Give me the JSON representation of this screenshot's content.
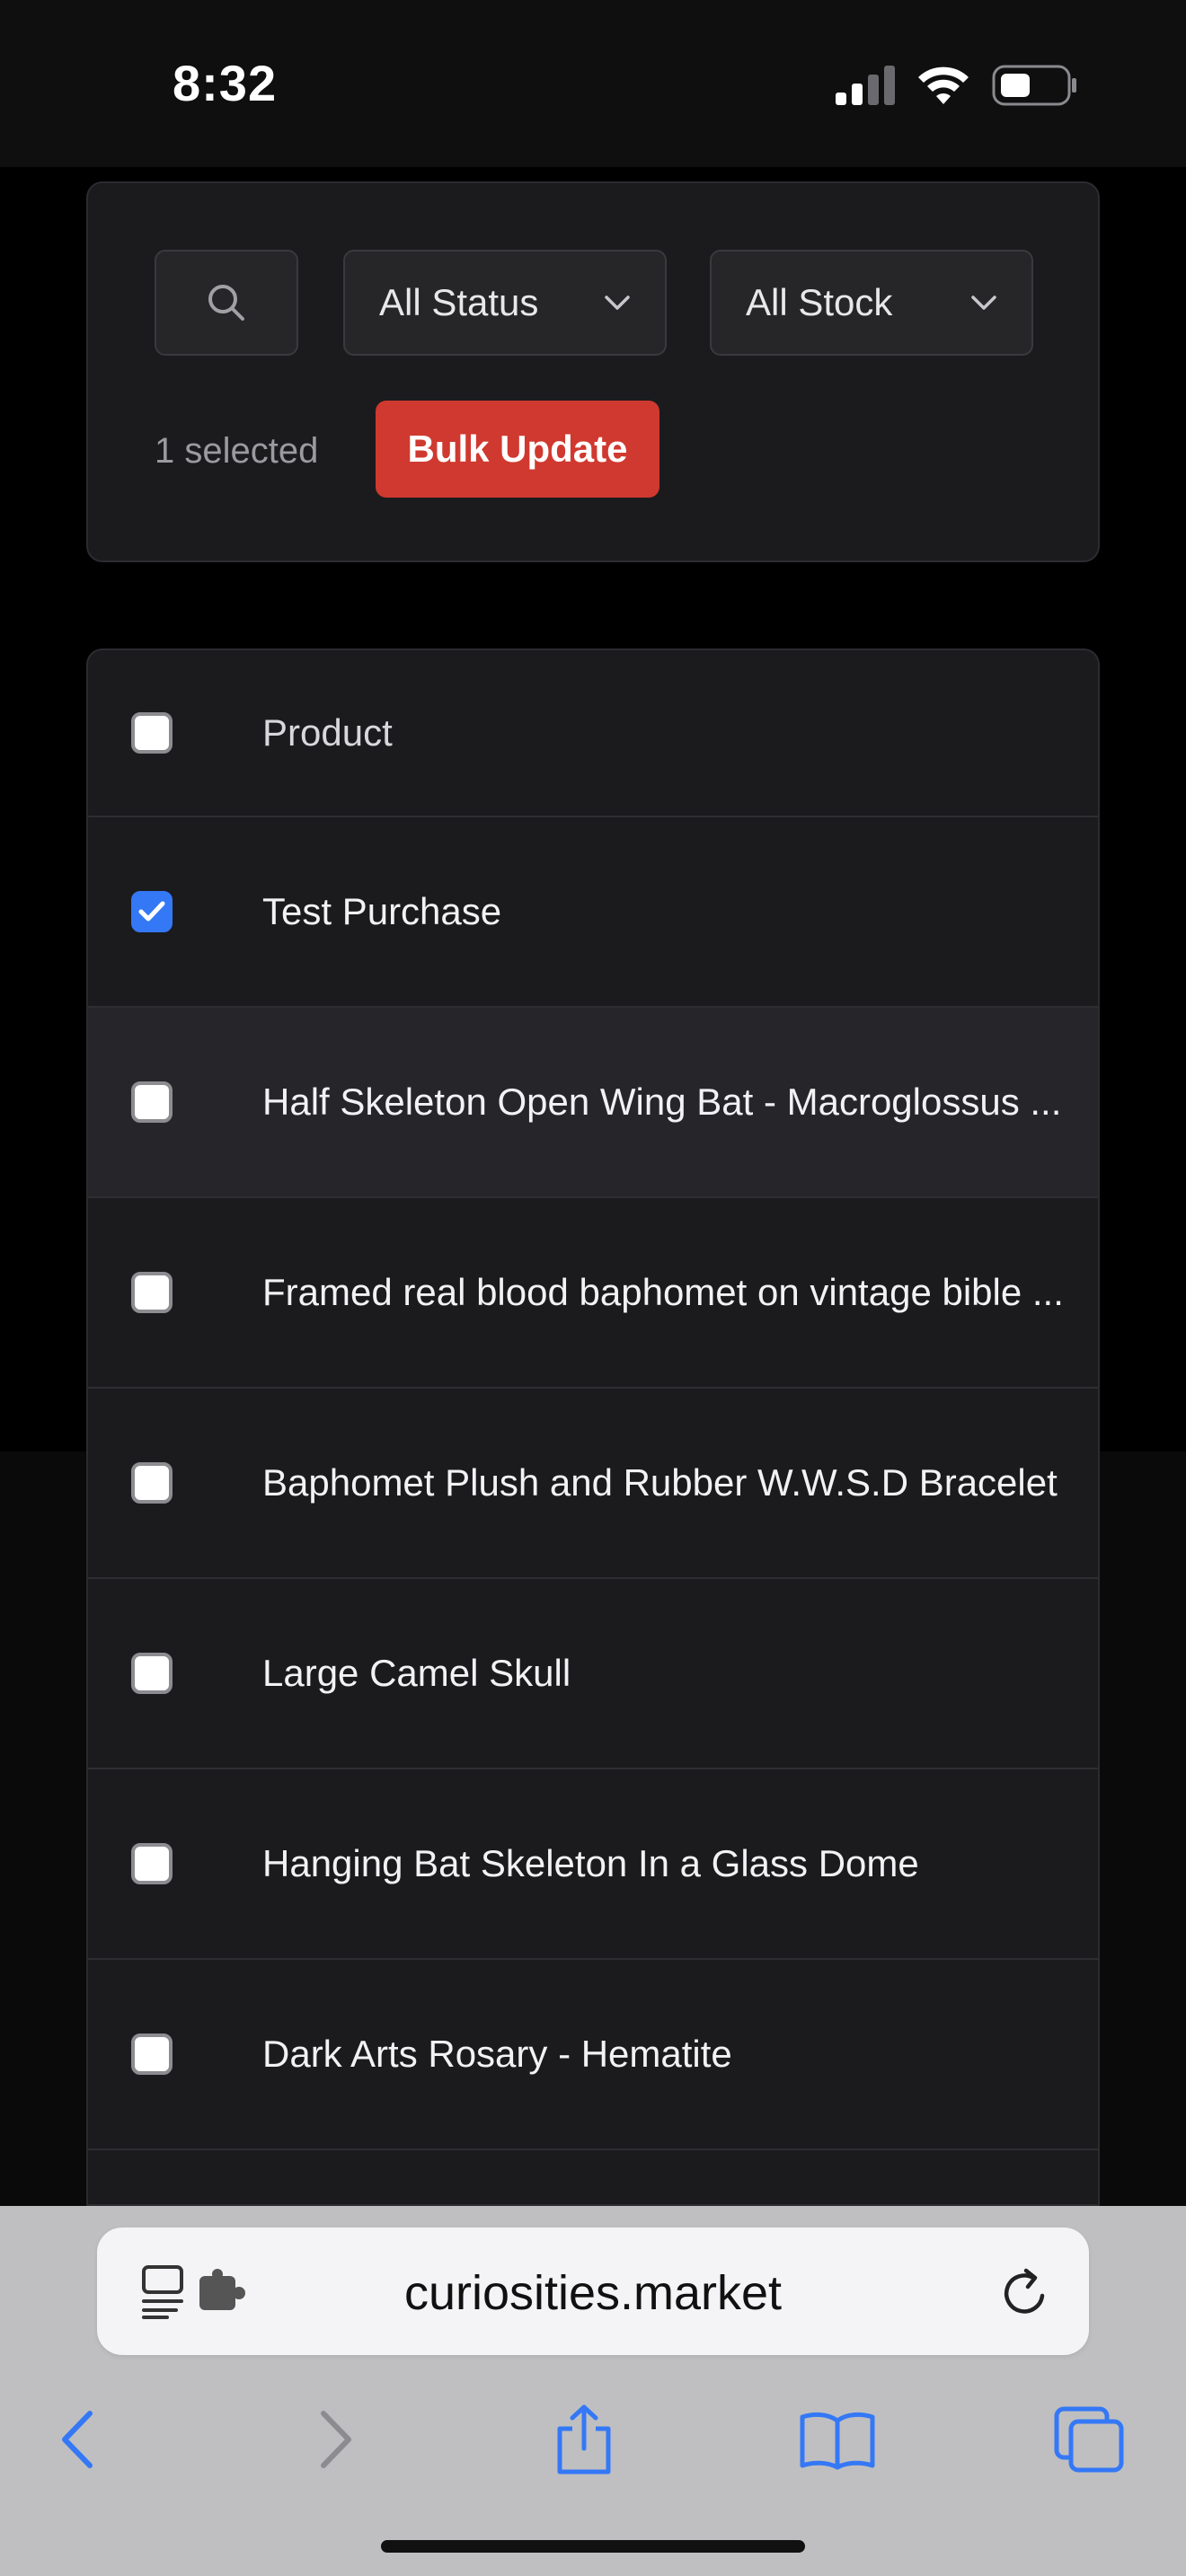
{
  "status_bar": {
    "time": "8:32"
  },
  "filters": {
    "status_select": "All Status",
    "stock_select": "All Stock",
    "selected_count": "1 selected",
    "bulk_update_label": "Bulk Update"
  },
  "table": {
    "header": "Product",
    "rows": [
      {
        "name": "Test Purchase",
        "checked": true
      },
      {
        "name": "Half Skeleton Open Wing Bat - Macroglossus ...",
        "checked": false
      },
      {
        "name": "Framed real blood baphomet on vintage bible ...",
        "checked": false
      },
      {
        "name": "Baphomet Plush and Rubber W.W.S.D Bracelet",
        "checked": false
      },
      {
        "name": "Large Camel Skull",
        "checked": false
      },
      {
        "name": "Hanging Bat Skeleton In a Glass Dome",
        "checked": false
      },
      {
        "name": "Dark Arts Rosary - Hematite",
        "checked": false
      }
    ]
  },
  "browser": {
    "url": "curiosities.market"
  },
  "colors": {
    "accent_red": "#d0392f",
    "checkbox_blue": "#3478f6",
    "card_bg": "#1b1b1e",
    "ios_blue": "#3478f6"
  }
}
